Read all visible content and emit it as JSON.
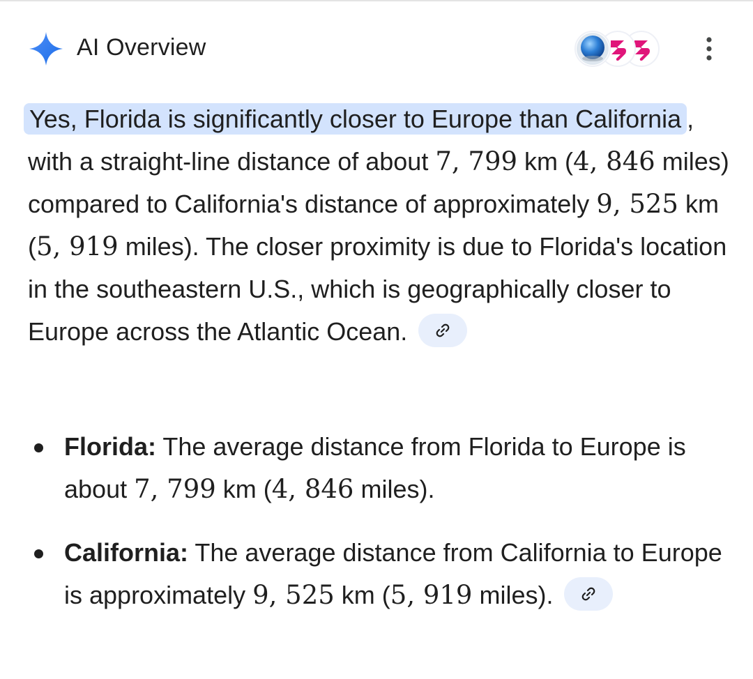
{
  "header": {
    "title": "AI Overview",
    "icons": [
      "sparkle-icon",
      "globe-source-icon",
      "source-logo-icon",
      "source-logo-icon",
      "more-vert-icon"
    ],
    "accent_color": "#1a73e8"
  },
  "summary": {
    "highlight": "Yes, Florida is significantly closer to Europe than California",
    "t1": ", with a straight-line distance of about ",
    "n1": "7, 799",
    "t2": " km (",
    "n2": "4, 846",
    "t3": " miles) compared to California's distance of approximately ",
    "n3": "9, 525",
    "t4": " km (",
    "n4": "5, 919",
    "t5": " miles). The closer proximity is due to Florida's location in the southeastern U.S., which is geographically closer to Europe across the Atlantic Ocean."
  },
  "bullets": [
    {
      "label": "Florida:",
      "a": " The average distance from Florida to Europe is about ",
      "n1": "7, 799",
      "b": " km (",
      "n2": "4, 846",
      "c": " miles)."
    },
    {
      "label": "California:",
      "a": " The average distance from California to Europe is approximately ",
      "n1": "9, 525",
      "b": " km (",
      "n2": "5, 919",
      "c": " miles)."
    }
  ],
  "colors": {
    "highlight_bg": "#d3e3fd",
    "chip_bg": "#e8effc",
    "text": "#1f1f1f"
  }
}
